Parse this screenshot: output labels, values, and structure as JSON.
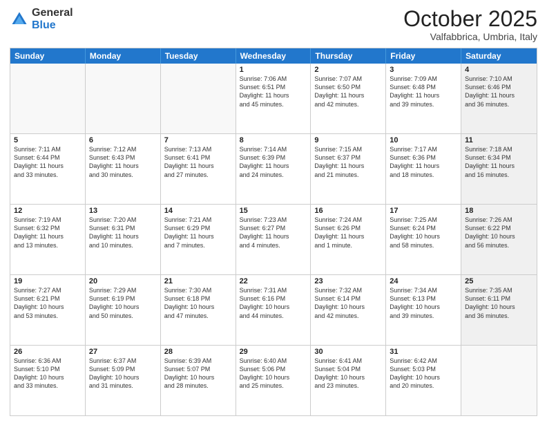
{
  "header": {
    "logo": {
      "general": "General",
      "blue": "Blue"
    },
    "title": "October 2025",
    "location": "Valfabbrica, Umbria, Italy"
  },
  "weekdays": [
    "Sunday",
    "Monday",
    "Tuesday",
    "Wednesday",
    "Thursday",
    "Friday",
    "Saturday"
  ],
  "rows": [
    [
      {
        "day": "",
        "lines": []
      },
      {
        "day": "",
        "lines": []
      },
      {
        "day": "",
        "lines": []
      },
      {
        "day": "1",
        "lines": [
          "Sunrise: 7:06 AM",
          "Sunset: 6:51 PM",
          "Daylight: 11 hours",
          "and 45 minutes."
        ]
      },
      {
        "day": "2",
        "lines": [
          "Sunrise: 7:07 AM",
          "Sunset: 6:50 PM",
          "Daylight: 11 hours",
          "and 42 minutes."
        ]
      },
      {
        "day": "3",
        "lines": [
          "Sunrise: 7:09 AM",
          "Sunset: 6:48 PM",
          "Daylight: 11 hours",
          "and 39 minutes."
        ]
      },
      {
        "day": "4",
        "lines": [
          "Sunrise: 7:10 AM",
          "Sunset: 6:46 PM",
          "Daylight: 11 hours",
          "and 36 minutes."
        ]
      }
    ],
    [
      {
        "day": "5",
        "lines": [
          "Sunrise: 7:11 AM",
          "Sunset: 6:44 PM",
          "Daylight: 11 hours",
          "and 33 minutes."
        ]
      },
      {
        "day": "6",
        "lines": [
          "Sunrise: 7:12 AM",
          "Sunset: 6:43 PM",
          "Daylight: 11 hours",
          "and 30 minutes."
        ]
      },
      {
        "day": "7",
        "lines": [
          "Sunrise: 7:13 AM",
          "Sunset: 6:41 PM",
          "Daylight: 11 hours",
          "and 27 minutes."
        ]
      },
      {
        "day": "8",
        "lines": [
          "Sunrise: 7:14 AM",
          "Sunset: 6:39 PM",
          "Daylight: 11 hours",
          "and 24 minutes."
        ]
      },
      {
        "day": "9",
        "lines": [
          "Sunrise: 7:15 AM",
          "Sunset: 6:37 PM",
          "Daylight: 11 hours",
          "and 21 minutes."
        ]
      },
      {
        "day": "10",
        "lines": [
          "Sunrise: 7:17 AM",
          "Sunset: 6:36 PM",
          "Daylight: 11 hours",
          "and 18 minutes."
        ]
      },
      {
        "day": "11",
        "lines": [
          "Sunrise: 7:18 AM",
          "Sunset: 6:34 PM",
          "Daylight: 11 hours",
          "and 16 minutes."
        ]
      }
    ],
    [
      {
        "day": "12",
        "lines": [
          "Sunrise: 7:19 AM",
          "Sunset: 6:32 PM",
          "Daylight: 11 hours",
          "and 13 minutes."
        ]
      },
      {
        "day": "13",
        "lines": [
          "Sunrise: 7:20 AM",
          "Sunset: 6:31 PM",
          "Daylight: 11 hours",
          "and 10 minutes."
        ]
      },
      {
        "day": "14",
        "lines": [
          "Sunrise: 7:21 AM",
          "Sunset: 6:29 PM",
          "Daylight: 11 hours",
          "and 7 minutes."
        ]
      },
      {
        "day": "15",
        "lines": [
          "Sunrise: 7:23 AM",
          "Sunset: 6:27 PM",
          "Daylight: 11 hours",
          "and 4 minutes."
        ]
      },
      {
        "day": "16",
        "lines": [
          "Sunrise: 7:24 AM",
          "Sunset: 6:26 PM",
          "Daylight: 11 hours",
          "and 1 minute."
        ]
      },
      {
        "day": "17",
        "lines": [
          "Sunrise: 7:25 AM",
          "Sunset: 6:24 PM",
          "Daylight: 10 hours",
          "and 58 minutes."
        ]
      },
      {
        "day": "18",
        "lines": [
          "Sunrise: 7:26 AM",
          "Sunset: 6:22 PM",
          "Daylight: 10 hours",
          "and 56 minutes."
        ]
      }
    ],
    [
      {
        "day": "19",
        "lines": [
          "Sunrise: 7:27 AM",
          "Sunset: 6:21 PM",
          "Daylight: 10 hours",
          "and 53 minutes."
        ]
      },
      {
        "day": "20",
        "lines": [
          "Sunrise: 7:29 AM",
          "Sunset: 6:19 PM",
          "Daylight: 10 hours",
          "and 50 minutes."
        ]
      },
      {
        "day": "21",
        "lines": [
          "Sunrise: 7:30 AM",
          "Sunset: 6:18 PM",
          "Daylight: 10 hours",
          "and 47 minutes."
        ]
      },
      {
        "day": "22",
        "lines": [
          "Sunrise: 7:31 AM",
          "Sunset: 6:16 PM",
          "Daylight: 10 hours",
          "and 44 minutes."
        ]
      },
      {
        "day": "23",
        "lines": [
          "Sunrise: 7:32 AM",
          "Sunset: 6:14 PM",
          "Daylight: 10 hours",
          "and 42 minutes."
        ]
      },
      {
        "day": "24",
        "lines": [
          "Sunrise: 7:34 AM",
          "Sunset: 6:13 PM",
          "Daylight: 10 hours",
          "and 39 minutes."
        ]
      },
      {
        "day": "25",
        "lines": [
          "Sunrise: 7:35 AM",
          "Sunset: 6:11 PM",
          "Daylight: 10 hours",
          "and 36 minutes."
        ]
      }
    ],
    [
      {
        "day": "26",
        "lines": [
          "Sunrise: 6:36 AM",
          "Sunset: 5:10 PM",
          "Daylight: 10 hours",
          "and 33 minutes."
        ]
      },
      {
        "day": "27",
        "lines": [
          "Sunrise: 6:37 AM",
          "Sunset: 5:09 PM",
          "Daylight: 10 hours",
          "and 31 minutes."
        ]
      },
      {
        "day": "28",
        "lines": [
          "Sunrise: 6:39 AM",
          "Sunset: 5:07 PM",
          "Daylight: 10 hours",
          "and 28 minutes."
        ]
      },
      {
        "day": "29",
        "lines": [
          "Sunrise: 6:40 AM",
          "Sunset: 5:06 PM",
          "Daylight: 10 hours",
          "and 25 minutes."
        ]
      },
      {
        "day": "30",
        "lines": [
          "Sunrise: 6:41 AM",
          "Sunset: 5:04 PM",
          "Daylight: 10 hours",
          "and 23 minutes."
        ]
      },
      {
        "day": "31",
        "lines": [
          "Sunrise: 6:42 AM",
          "Sunset: 5:03 PM",
          "Daylight: 10 hours",
          "and 20 minutes."
        ]
      },
      {
        "day": "",
        "lines": []
      }
    ]
  ]
}
